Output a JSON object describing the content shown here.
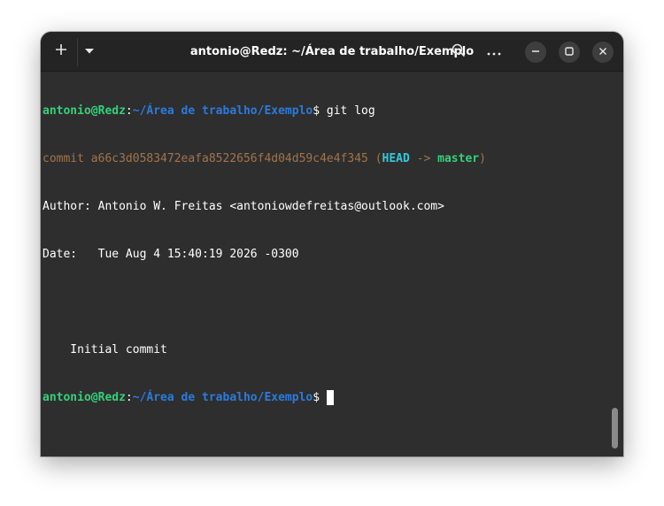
{
  "window": {
    "title": "antonio@Redz: ~/Área de trabalho/Exemplo"
  },
  "icons": {
    "new_tab": "plus-icon",
    "menu": "chevron-down-icon",
    "search": "search-icon",
    "more": "ellipsis-icon",
    "minimize": "minimize-icon",
    "maximize": "maximize-icon",
    "close": "close-icon"
  },
  "terminal": {
    "prompt_user": "antonio@Redz",
    "prompt_colon": ":",
    "prompt_path": "~/Área de trabalho/Exemplo",
    "prompt_dollar": "$",
    "command": " git log",
    "commit_prefix": "commit a66c3d0583472eafa8522656f4d04d59c4e4f345 ",
    "commit_paren_open": "(",
    "commit_head": "HEAD",
    "commit_arrow": " -> ",
    "commit_branch": "master",
    "commit_paren_close": ")",
    "author_line": "Author: Antonio W. Freitas <antoniowdefreitas@outlook.com>",
    "date_line": "Date:   Tue Aug 4 15:40:19 2026 -0300",
    "blank_line": "",
    "message_line": "    Initial commit"
  },
  "colors": {
    "user": "#33d17a",
    "path": "#2a7bde",
    "commit": "#a2734c",
    "head": "#33c7de",
    "branch": "#33d17a",
    "background": "#2e2e2e",
    "titlebar": "#242424"
  }
}
